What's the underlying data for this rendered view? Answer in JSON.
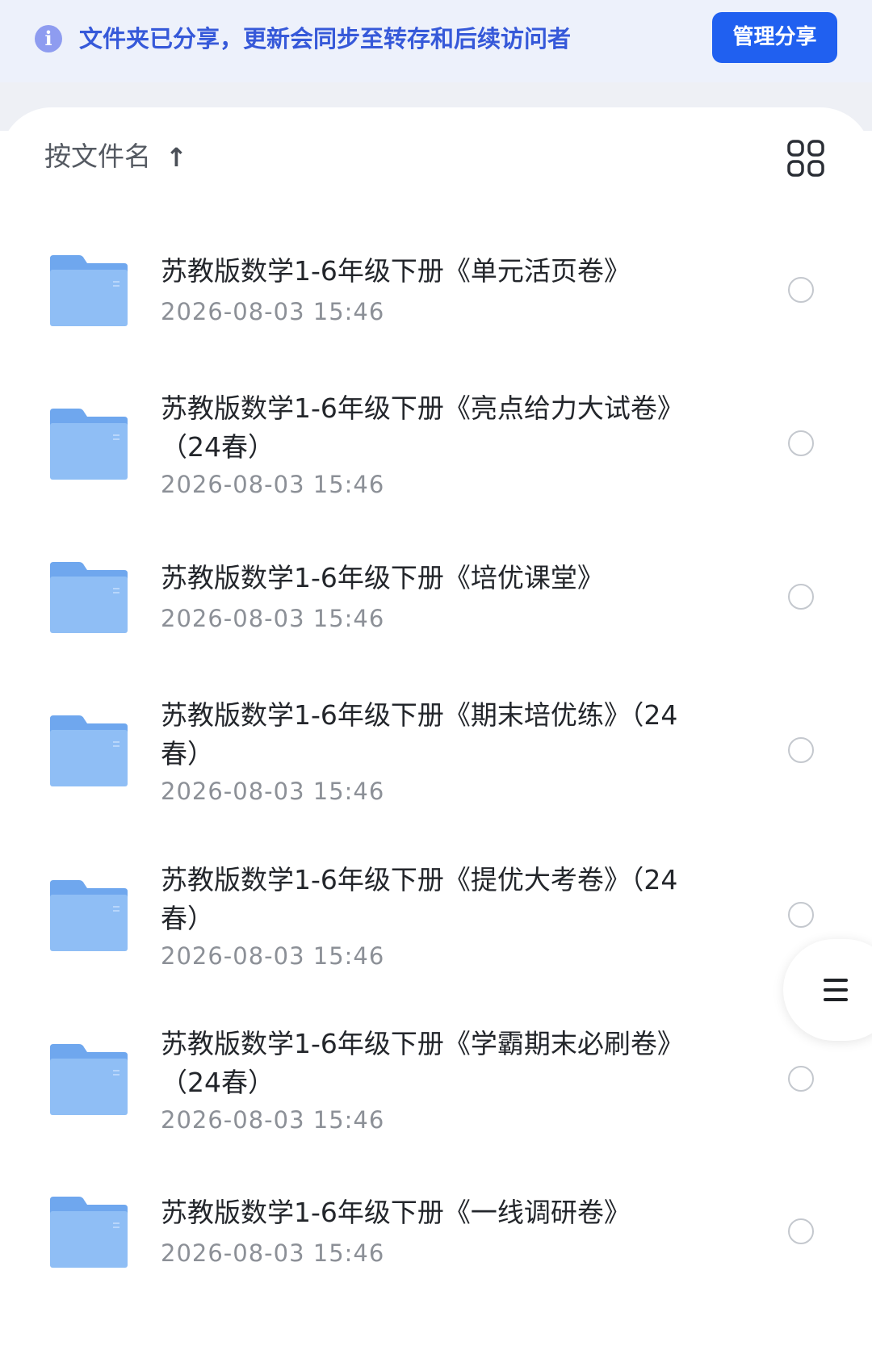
{
  "banner": {
    "info_icon": "info-icon",
    "text": "文件夹已分享，更新会同步至转存和后续访问者",
    "button_label": "管理分享"
  },
  "toolbar": {
    "sort_label": "按文件名",
    "sort_icon": "arrow-up-icon",
    "view_icon": "grid-view-icon"
  },
  "files": [
    {
      "name": "苏教版数学1-6年级下册《单元活页卷》",
      "date": "2026-08-03 15:46"
    },
    {
      "name": "苏教版数学1-6年级下册《亮点给力大试卷》（24春）",
      "date": "2026-08-03 15:46"
    },
    {
      "name": "苏教版数学1-6年级下册《培优课堂》",
      "date": "2026-08-03 15:46"
    },
    {
      "name": "苏教版数学1-6年级下册《期末培优练》（24春）",
      "date": "2026-08-03 15:46"
    },
    {
      "name": "苏教版数学1-6年级下册《提优大考卷》（24春）",
      "date": "2026-08-03 15:46"
    },
    {
      "name": "苏教版数学1-6年级下册《学霸期末必刷卷》（24春）",
      "date": "2026-08-03 15:46"
    },
    {
      "name": "苏教版数学1-6年级下册《一线调研卷》",
      "date": "2026-08-03 15:46"
    }
  ],
  "floating": {
    "icon": "menu-lines-icon"
  },
  "colors": {
    "accent": "#2060f0",
    "banner_bg": "#edf1fb",
    "banner_text": "#3659d9",
    "folder": "#8fbef5"
  }
}
